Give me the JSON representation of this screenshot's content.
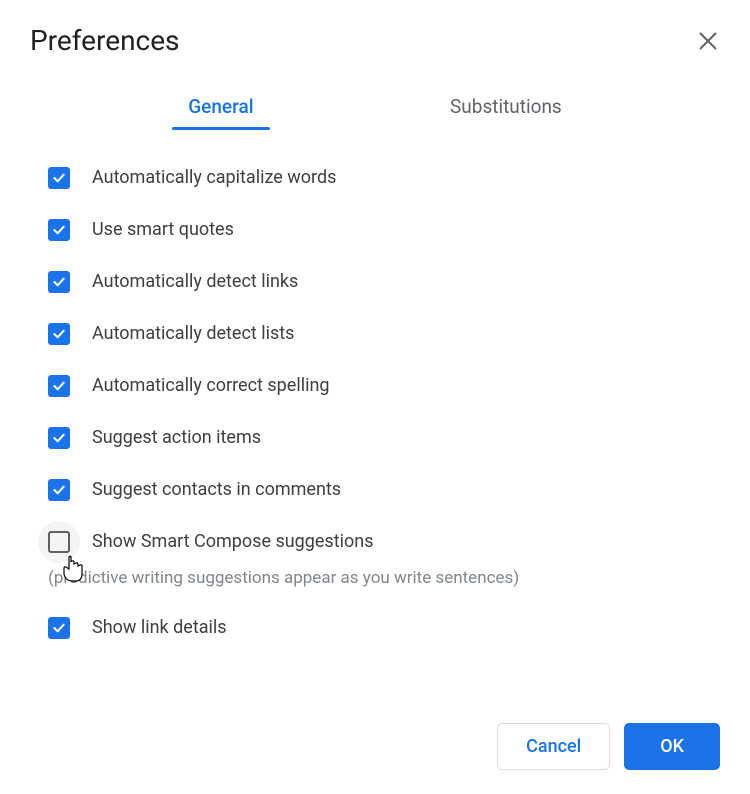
{
  "header": {
    "title": "Preferences"
  },
  "tabs": {
    "general": "General",
    "substitutions": "Substitutions"
  },
  "options": [
    {
      "label": "Automatically capitalize words",
      "checked": true
    },
    {
      "label": "Use smart quotes",
      "checked": true
    },
    {
      "label": "Automatically detect links",
      "checked": true
    },
    {
      "label": "Automatically detect lists",
      "checked": true
    },
    {
      "label": "Automatically correct spelling",
      "checked": true
    },
    {
      "label": "Suggest action items",
      "checked": true
    },
    {
      "label": "Suggest contacts in comments",
      "checked": true
    },
    {
      "label": "Show Smart Compose suggestions",
      "checked": false,
      "description": "(predictive writing suggestions appear as you write sentences)",
      "hover": true
    },
    {
      "label": "Show link details",
      "checked": true
    }
  ],
  "footer": {
    "cancel": "Cancel",
    "ok": "OK"
  }
}
